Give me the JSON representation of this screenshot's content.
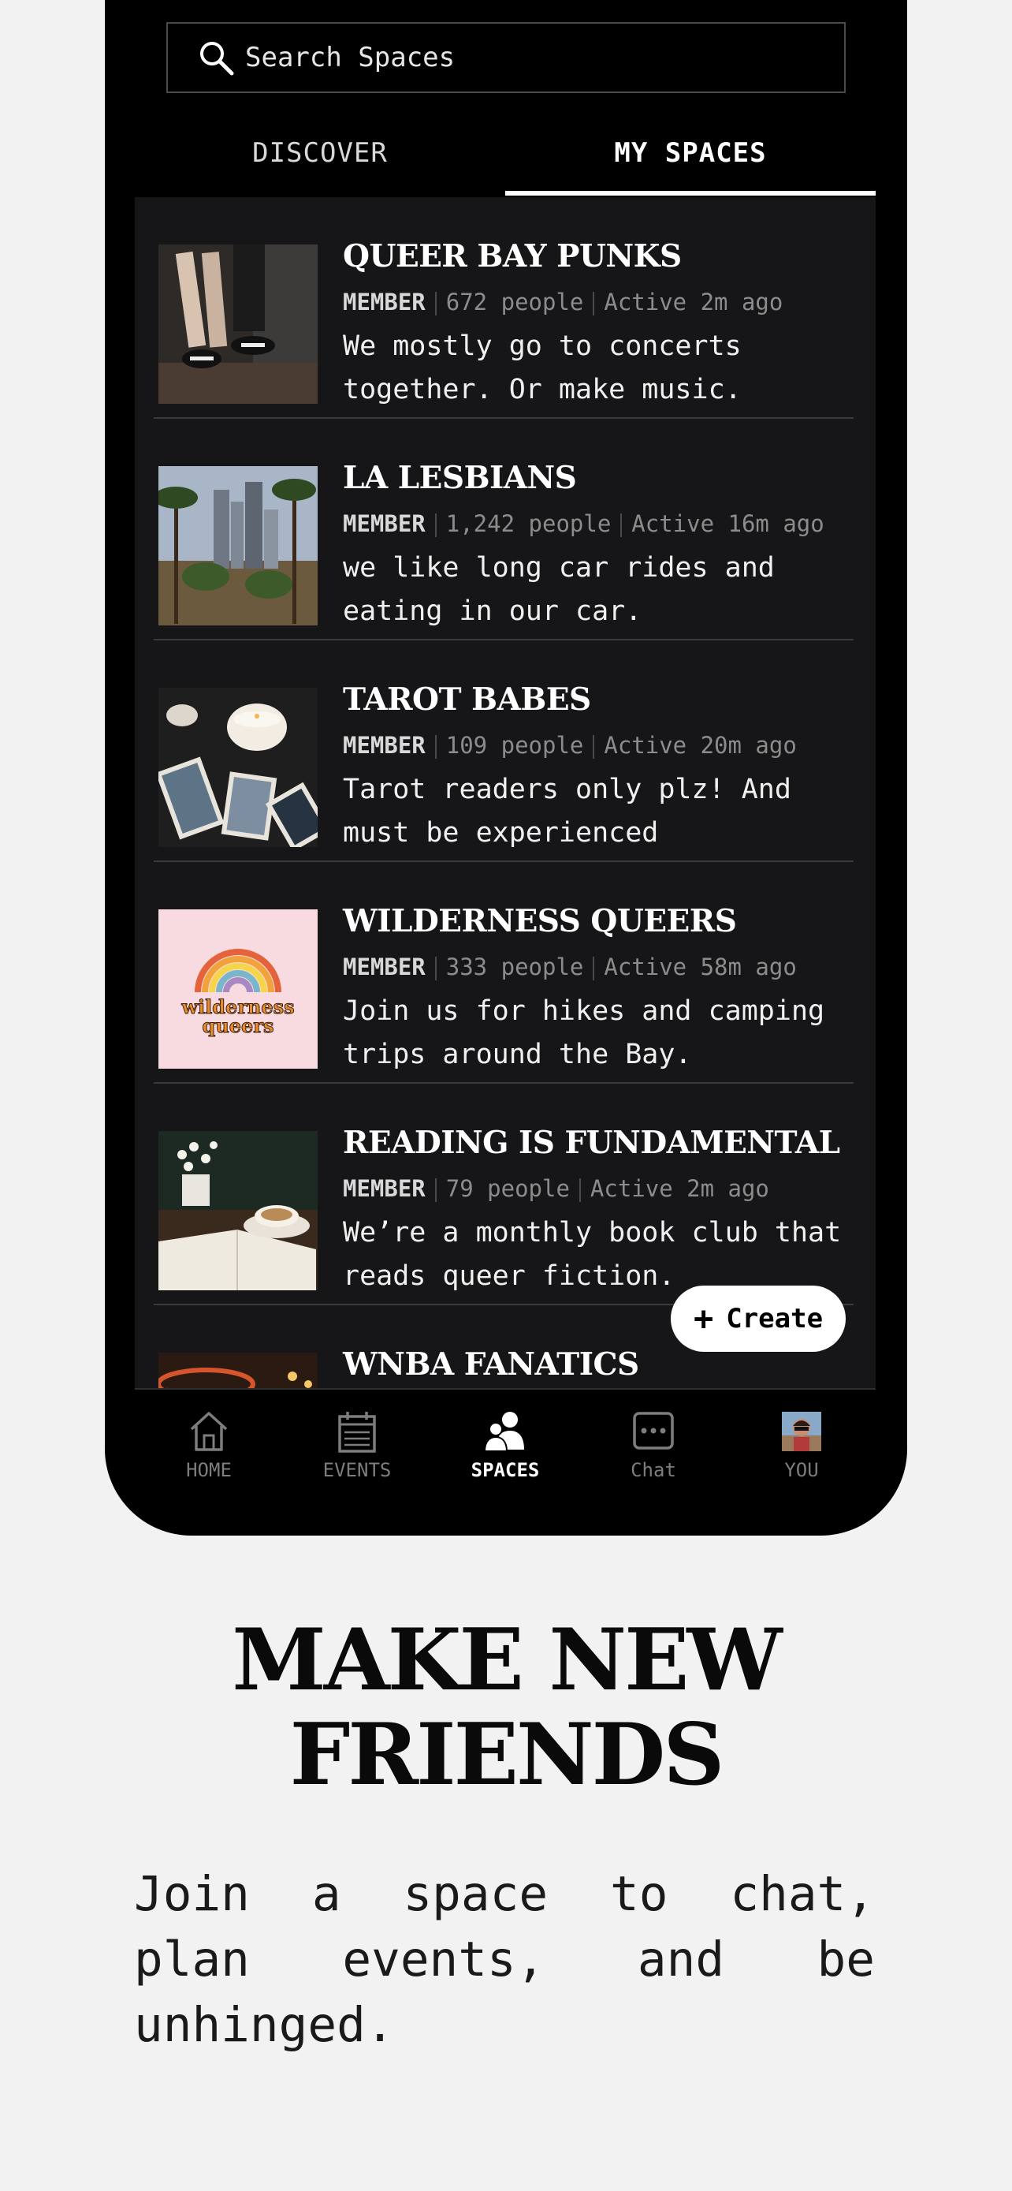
{
  "search": {
    "placeholder": "Search Spaces",
    "icon": "search-icon"
  },
  "tabs": [
    {
      "label": "DISCOVER",
      "active": false
    },
    {
      "label": "MY SPACES",
      "active": true
    }
  ],
  "spaces": [
    {
      "title": "QUEER BAY PUNKS",
      "role": "MEMBER",
      "people": "672 people",
      "active": "Active 2m ago",
      "desc": "We mostly go to concerts together. Or make music.",
      "thumb": "sneakers-photo"
    },
    {
      "title": "LA LESBIANS",
      "role": "MEMBER",
      "people": "1,242 people",
      "active": "Active 16m ago",
      "desc": "we like long car rides and eating in our car.",
      "thumb": "palm-trees-skyline-photo"
    },
    {
      "title": "TAROT BABES",
      "role": "MEMBER",
      "people": "109 people",
      "active": "Active 20m ago",
      "desc": "Tarot readers only plz! And must be experienced",
      "thumb": "tarot-cards-photo"
    },
    {
      "title": "WILDERNESS QUEERS",
      "role": "MEMBER",
      "people": "333 people",
      "active": "Active 58m ago",
      "desc": "Join us for hikes and camping trips around the Bay.",
      "thumb": "rainbow-logo",
      "logo_text_1": "wilderness",
      "logo_text_2": "queers"
    },
    {
      "title": "READING IS FUNDAMENTAL",
      "role": "MEMBER",
      "people": "79 people",
      "active": "Active 2m ago",
      "desc": "We’re a monthly book club that reads queer fiction.",
      "thumb": "book-tea-photo"
    },
    {
      "title": "WNBA FANATICS",
      "role": "",
      "people": "",
      "active": "",
      "desc": "",
      "thumb": "basketball-hoop-photo"
    }
  ],
  "create_button": {
    "label": "Create",
    "icon": "plus-icon"
  },
  "nav": [
    {
      "label": "HOME",
      "icon": "home-icon",
      "active": false
    },
    {
      "label": "EVENTS",
      "icon": "calendar-icon",
      "active": false
    },
    {
      "label": "SPACES",
      "icon": "people-icon",
      "active": true
    },
    {
      "label": "Chat",
      "icon": "chat-icon",
      "active": false
    },
    {
      "label": "YOU",
      "icon": "avatar",
      "active": false
    }
  ],
  "promo": {
    "headline_line1": "MAKE NEW",
    "headline_line2": "FRIENDS",
    "subtext": "Join a space to chat, plan events, and be unhinged."
  },
  "colors": {
    "background": "#f2f2f2",
    "phone": "#000000",
    "list_bg": "#161618",
    "accent": "#ffffff"
  }
}
